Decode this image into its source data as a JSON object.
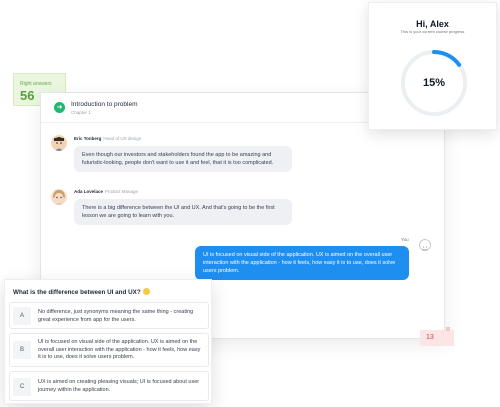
{
  "right_answers": {
    "label": "Right answers",
    "value": "56"
  },
  "wrong_badge": {
    "value": "13"
  },
  "lesson": {
    "title": "Introduction to problem",
    "chapter": "Chapter 1"
  },
  "messages": [
    {
      "name": "Eric Tonberg",
      "role": "Head of UX design",
      "text": "Even though our investors and stakeholders found the app to be amazing and futuristic-looking, people don't want to use it and feel, that it is too complicated."
    },
    {
      "name": "Ada Lovelace",
      "role": "Product Manage",
      "text": "There is a big difference between the UI and UX. And that's going to be the first lesson we are going to learn with you."
    }
  ],
  "you": {
    "label": "You",
    "text": "UI is focused on visual side of the application. UX is aimed on the overall user interaction with the application - how it feels, how easy it is to use, does it solve users problem."
  },
  "progress": {
    "greeting": "Hi, Alex",
    "subtitle": "This is your current course progress",
    "percent_label": "15%",
    "percent": 15,
    "ring_color": "#1f8ef1"
  },
  "quiz": {
    "question": "What is the difference between UI and UX?",
    "options": [
      {
        "letter": "A",
        "text": "No difference, just synonyms meaning the same thing - creating great experience from app for the users."
      },
      {
        "letter": "B",
        "text": "UI is focused on visual side of the application. UX is aimed on the overall user interaction with the application - how it feels, how easy it is to use, does it solve users problem."
      },
      {
        "letter": "C",
        "text": "UX is aimed on creating pleasing visuals; UI is focused about user journey within the application."
      }
    ]
  }
}
